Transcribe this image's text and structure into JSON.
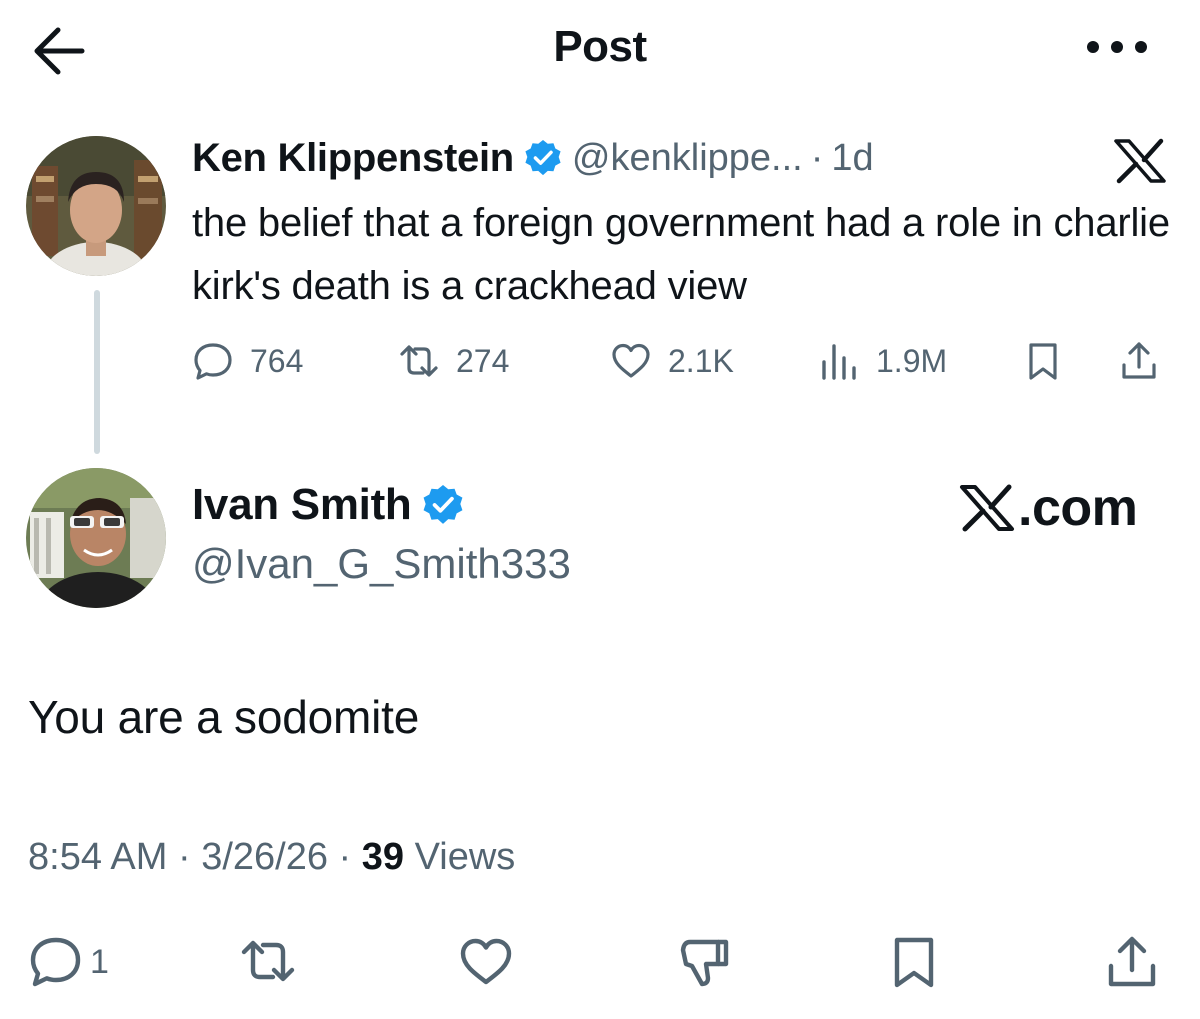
{
  "header": {
    "title": "Post",
    "back_icon": "arrow-left-icon",
    "more_icon": "more-horizontal-icon"
  },
  "quoted_tweet": {
    "author_name": "Ken Klippenstein",
    "verified": true,
    "handle": "@kenklippe...",
    "separator": "·",
    "time": "1d",
    "text": "the belief that a foreign government had a role in charlie kirk's death is a crackhead view",
    "stats": {
      "replies": "764",
      "reposts": "274",
      "likes": "2.1K",
      "views": "1.9M"
    }
  },
  "tweet": {
    "author_name": "Ivan Smith",
    "verified": true,
    "handle": "@Ivan_G_Smith333",
    "text": "You are a sodomite",
    "meta": {
      "time": "8:54 AM",
      "sep1": " · ",
      "date": "3/26/26",
      "sep2": " · ",
      "views_count": "39",
      "views_label": " Views"
    },
    "actions": {
      "reply_count": "1"
    }
  },
  "watermark": {
    "text": ".com"
  },
  "colors": {
    "text": "#0f1419",
    "secondary": "#536471",
    "verified": "#1d9bf0",
    "thread_line": "#cfd9de"
  }
}
